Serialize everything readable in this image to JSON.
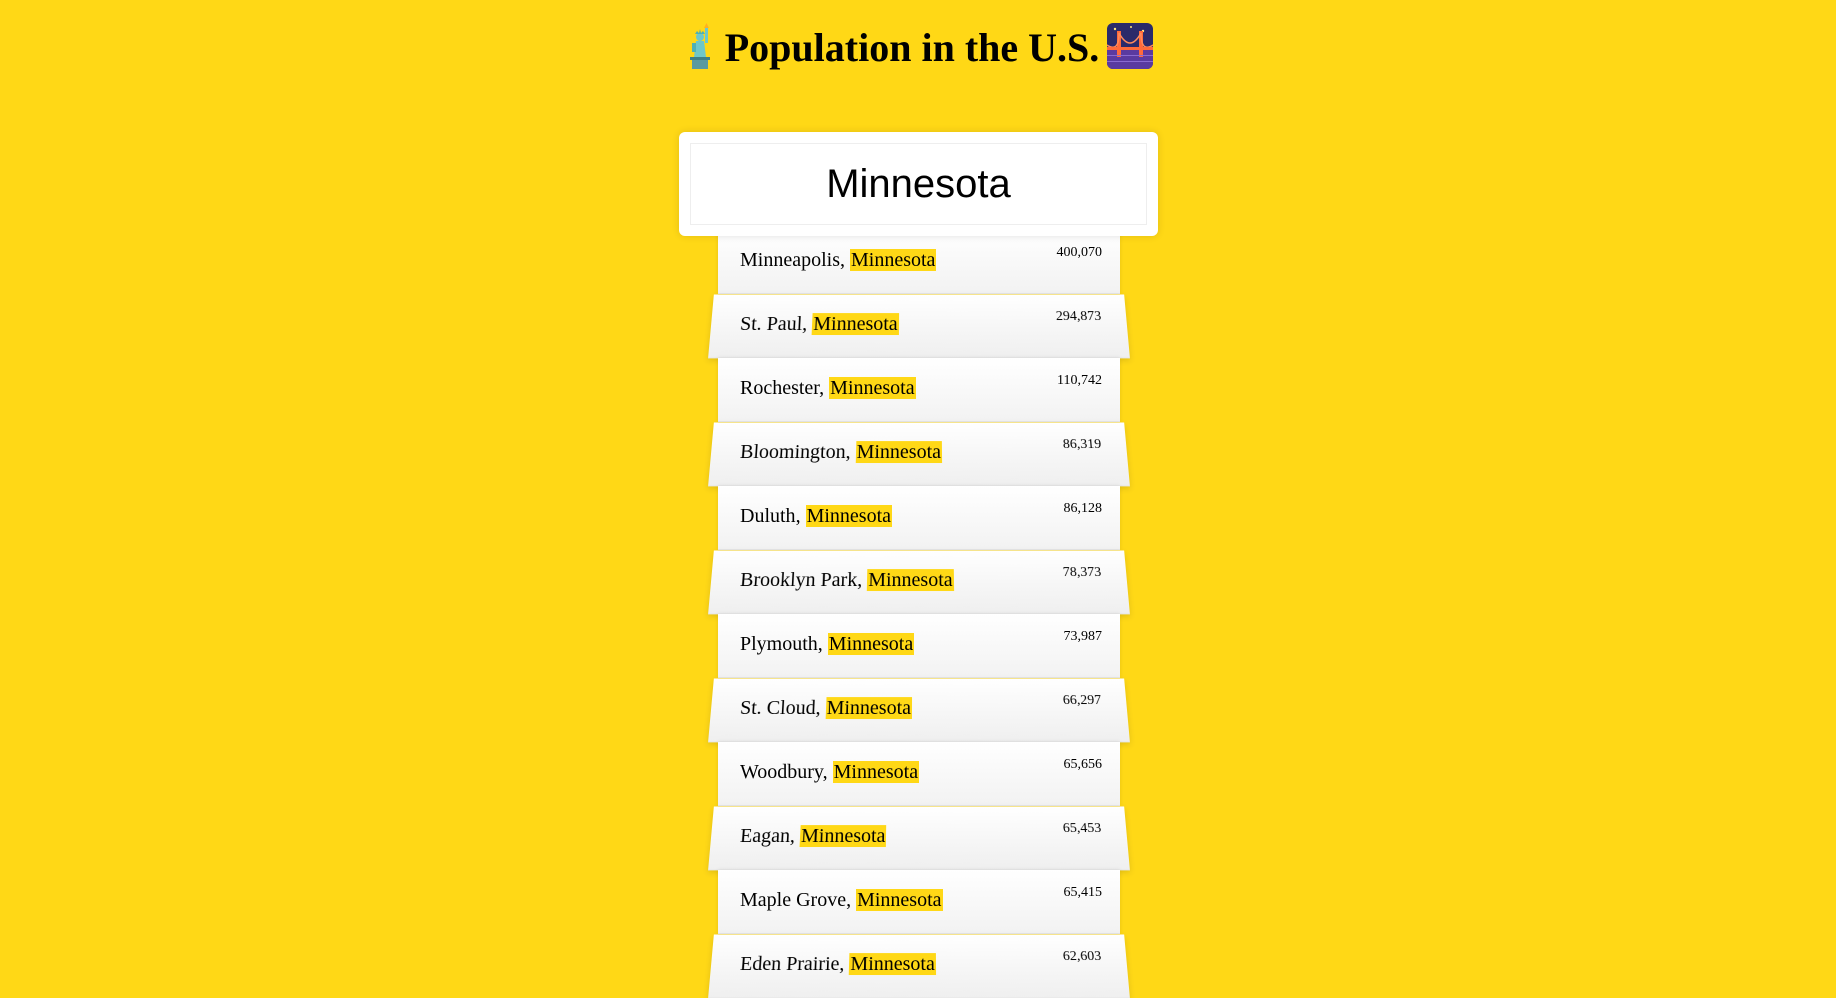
{
  "page": {
    "title": "Population in the U.S.",
    "title_icons": [
      "statue-of-liberty-icon",
      "bridge-at-night-icon"
    ],
    "background_color": "#ffd816",
    "highlight_color": "#ffd816"
  },
  "search": {
    "value": "Minnesota"
  },
  "results": [
    {
      "city": "Minneapolis",
      "state": "Minnesota",
      "population": "400,070"
    },
    {
      "city": "St. Paul",
      "state": "Minnesota",
      "population": "294,873"
    },
    {
      "city": "Rochester",
      "state": "Minnesota",
      "population": "110,742"
    },
    {
      "city": "Bloomington",
      "state": "Minnesota",
      "population": "86,319"
    },
    {
      "city": "Duluth",
      "state": "Minnesota",
      "population": "86,128"
    },
    {
      "city": "Brooklyn Park",
      "state": "Minnesota",
      "population": "78,373"
    },
    {
      "city": "Plymouth",
      "state": "Minnesota",
      "population": "73,987"
    },
    {
      "city": "St. Cloud",
      "state": "Minnesota",
      "population": "66,297"
    },
    {
      "city": "Woodbury",
      "state": "Minnesota",
      "population": "65,656"
    },
    {
      "city": "Eagan",
      "state": "Minnesota",
      "population": "65,453"
    },
    {
      "city": "Maple Grove",
      "state": "Minnesota",
      "population": "65,415"
    },
    {
      "city": "Eden Prairie",
      "state": "Minnesota",
      "population": "62,603"
    }
  ]
}
